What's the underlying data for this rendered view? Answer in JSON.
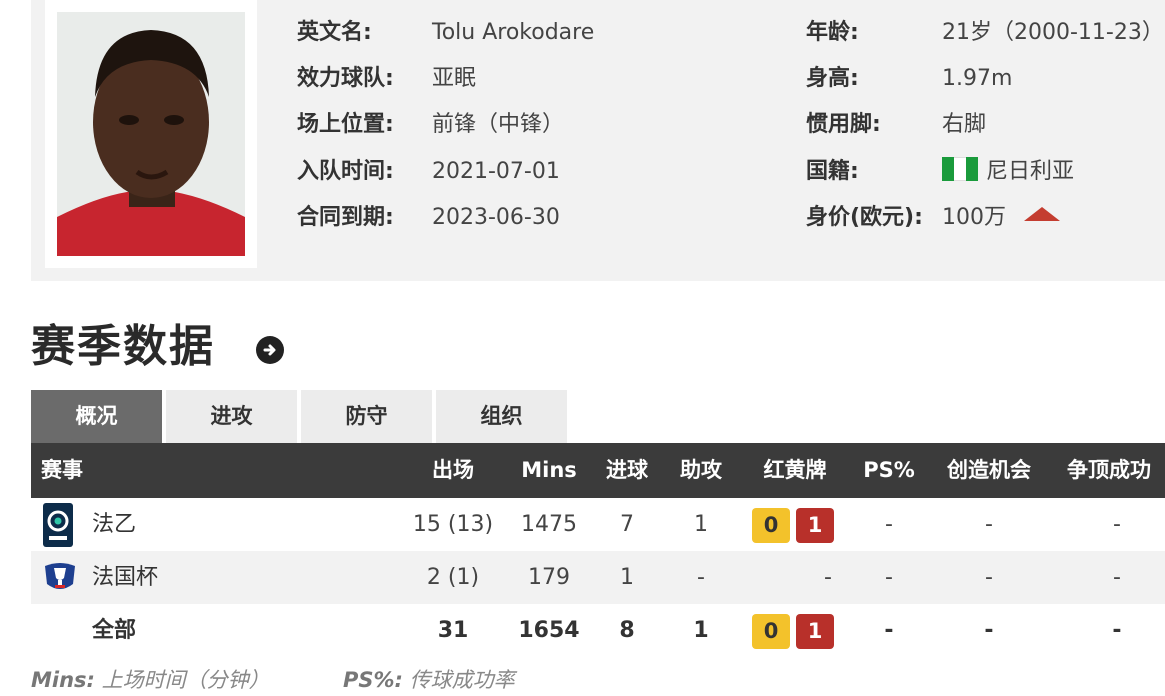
{
  "profile": {
    "fields_left": [
      {
        "label": "英文名:",
        "value": "Tolu Arokodare"
      },
      {
        "label": "效力球队:",
        "value": "亚眠"
      },
      {
        "label": "场上位置:",
        "value": "前锋（中锋）"
      },
      {
        "label": "入队时间:",
        "value": "2021-07-01"
      },
      {
        "label": "合同到期:",
        "value": "2023-06-30"
      }
    ],
    "fields_right": [
      {
        "label": "年龄:",
        "value": "21岁（2000-11-23）"
      },
      {
        "label": "身高:",
        "value": "1.97m"
      },
      {
        "label": "惯用脚:",
        "value": "右脚"
      },
      {
        "label": "国籍:",
        "value": "尼日利亚",
        "flag": [
          "#1a9b3c",
          "#ffffff",
          "#1a9b3c"
        ]
      },
      {
        "label": "身价(欧元):",
        "value": "100万",
        "trend_icon": "trend-up-icon",
        "trend_color": "#c43d30"
      }
    ]
  },
  "season": {
    "title": "赛季数据",
    "nav_icon": "arrow-right-circle-icon",
    "tabs": [
      "概况",
      "进攻",
      "防守",
      "组织"
    ],
    "active_tab": 0,
    "columns": [
      "赛事",
      "出场",
      "Mins",
      "进球",
      "助攻",
      "红黄牌",
      "PS%",
      "创造机会",
      "争顶成功"
    ],
    "rows": [
      {
        "competition": "法乙",
        "logo": "ligue2-logo-icon",
        "apps": "15 (13)",
        "mins": "1475",
        "goals": "7",
        "assists": "1",
        "yellow": "0",
        "red": "1",
        "ps": "-",
        "chances": "-",
        "aerials": "-"
      },
      {
        "competition": "法国杯",
        "logo": "coupe-de-france-logo-icon",
        "apps": "2 (1)",
        "mins": "179",
        "goals": "1",
        "assists": "-",
        "cards": "-",
        "ps": "-",
        "chances": "-",
        "aerials": "-"
      },
      {
        "competition": "全部",
        "apps": "31",
        "mins": "1654",
        "goals": "8",
        "assists": "1",
        "yellow": "0",
        "red": "1",
        "ps": "-",
        "chances": "-",
        "aerials": "-"
      }
    ],
    "card_colors": {
      "yellow": "#f3c22b",
      "red": "#b8302a"
    }
  },
  "footnotes": [
    {
      "term": "Mins:",
      "desc": "上场时间（分钟）"
    },
    {
      "term": "PS%:",
      "desc": "传球成功率"
    }
  ]
}
